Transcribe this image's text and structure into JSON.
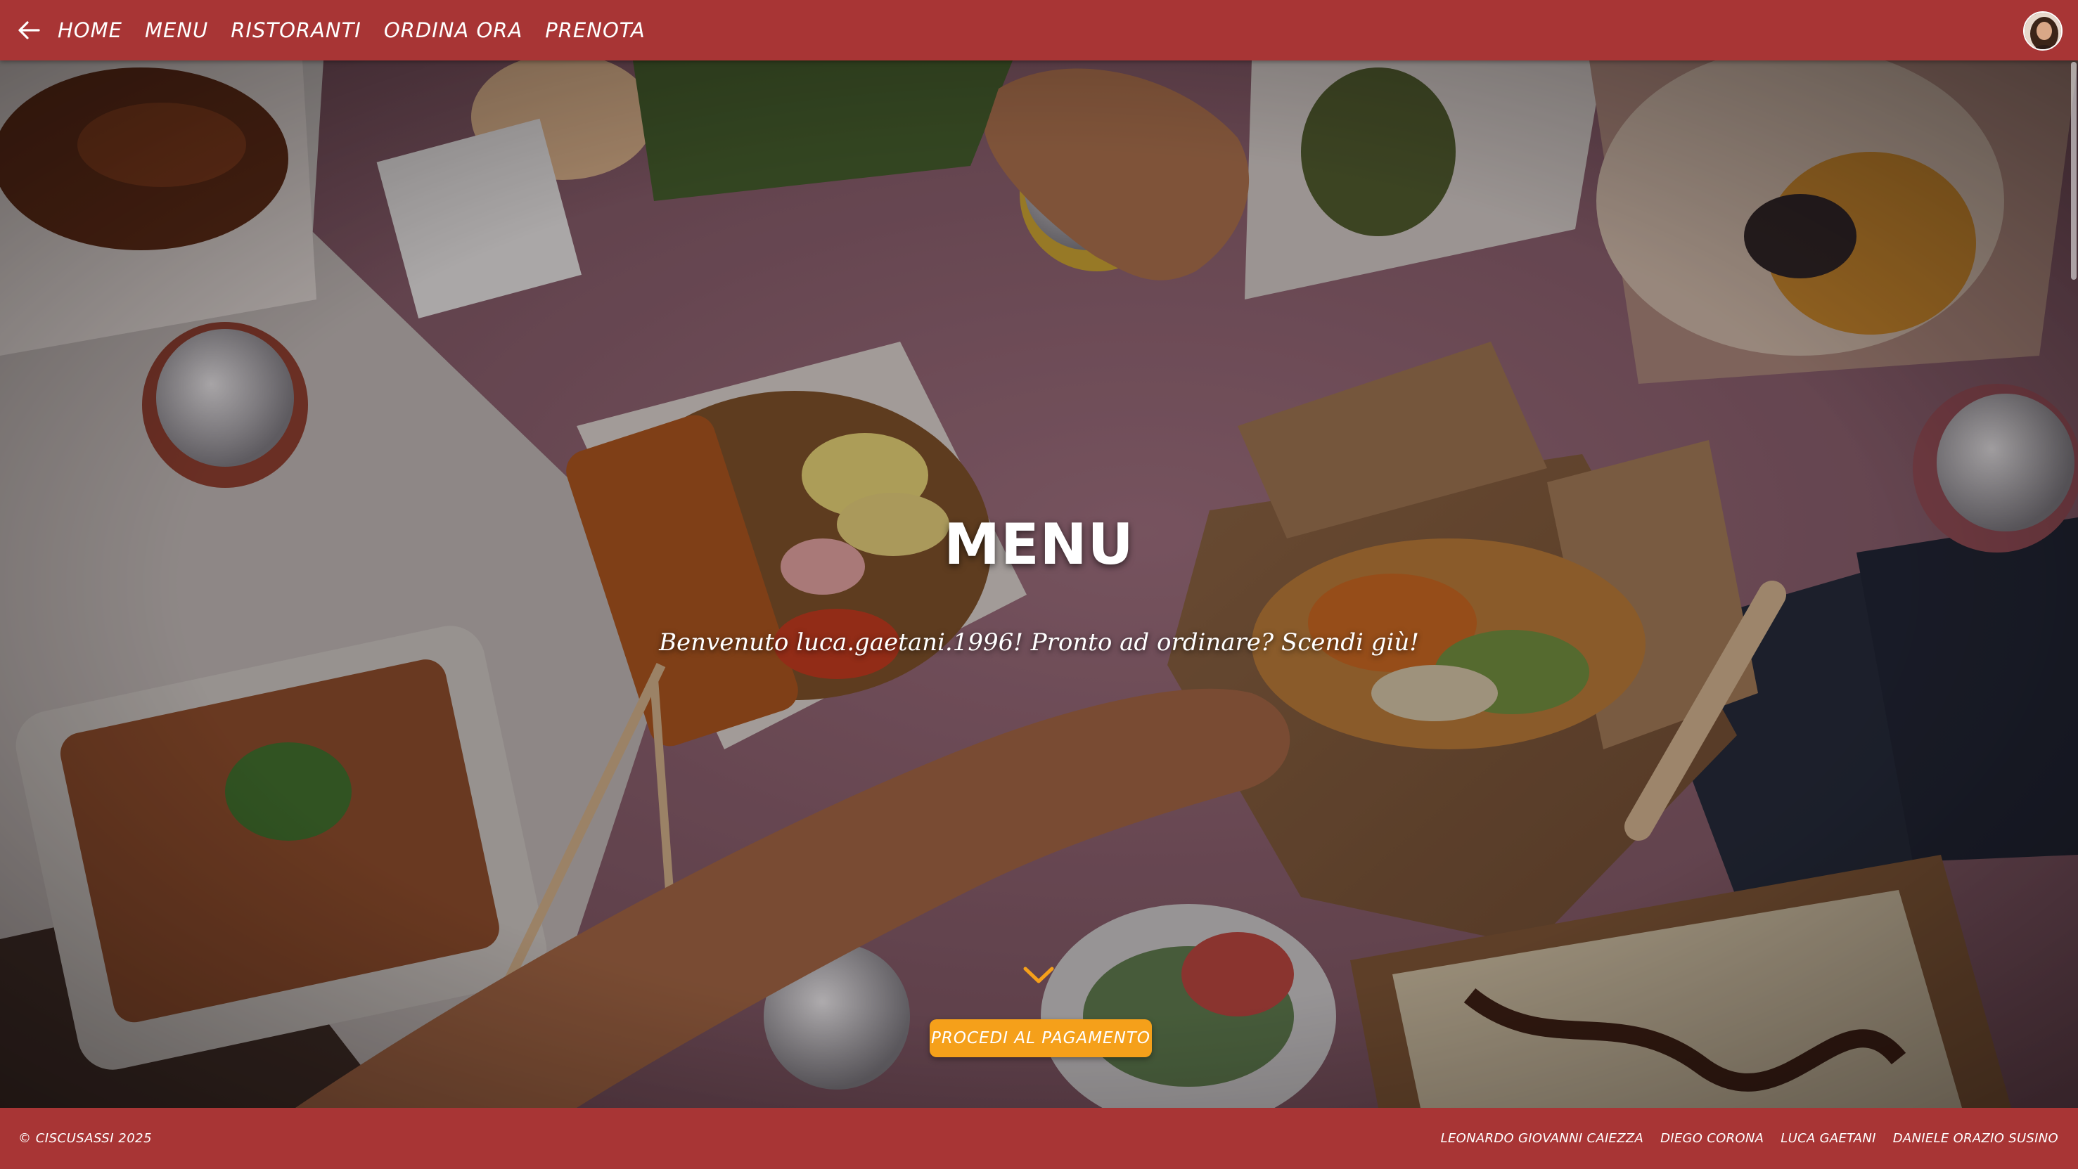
{
  "nav": {
    "back_icon": "arrow-left-icon",
    "links": [
      "HOME",
      "MENU",
      "RISTORANTI",
      "ORDINA ORA",
      "PRENOTA"
    ]
  },
  "user": {
    "avatar_icon": "user-avatar"
  },
  "hero": {
    "title": "MENU",
    "subtitle": "Benvenuto luca.gaetani.1996! Pronto ad ordinare? Scendi giù!",
    "scroll_icon": "chevron-down-icon",
    "pay_button": "PROCEDI AL PAGAMENTO"
  },
  "footer": {
    "copyright": "© CISCUSASSI 2025",
    "authors": [
      "LEONARDO GIOVANNI CAIEZZA",
      "DIEGO CORONA",
      "LUCA GAETANI",
      "DANIELE ORAZIO SUSINO"
    ]
  },
  "colors": {
    "primary": "#a83535",
    "accent": "#f5a01a",
    "text": "#ffffff"
  }
}
